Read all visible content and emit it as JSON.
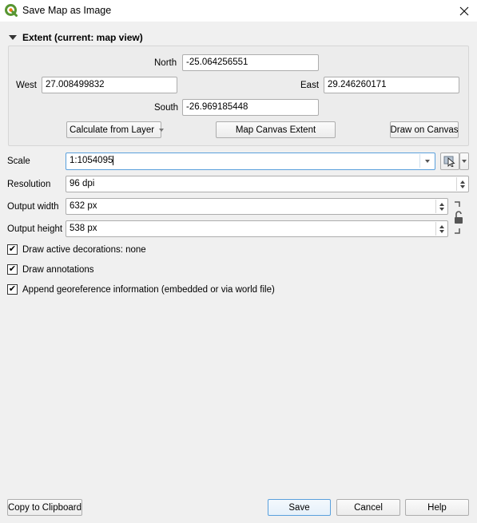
{
  "window": {
    "title": "Save Map as Image",
    "icon": "qgis-logo-icon",
    "close_icon": "close-icon"
  },
  "extent": {
    "header": "Extent (current: map view)",
    "north_label": "North",
    "north_value": "-25.064256551",
    "west_label": "West",
    "west_value": "27.008499832",
    "east_label": "East",
    "east_value": "29.246260171",
    "south_label": "South",
    "south_value": "-26.969185448",
    "calc_from_layer_label": "Calculate from Layer",
    "map_canvas_extent_label": "Map Canvas Extent",
    "draw_on_canvas_label": "Draw on Canvas"
  },
  "scale": {
    "label": "Scale",
    "value": "1:1054095"
  },
  "resolution": {
    "label": "Resolution",
    "value": "96 dpi"
  },
  "output_width": {
    "label": "Output width",
    "value": "632 px"
  },
  "output_height": {
    "label": "Output height",
    "value": "538 px"
  },
  "options": [
    {
      "label": "Draw active decorations: none",
      "checked": true
    },
    {
      "label": "Draw annotations",
      "checked": true
    },
    {
      "label": "Append georeference information (embedded or via world file)",
      "checked": true
    }
  ],
  "footer": {
    "copy_label": "Copy to Clipboard",
    "save_label": "Save",
    "cancel_label": "Cancel",
    "help_label": "Help"
  },
  "check_glyph": "✔"
}
